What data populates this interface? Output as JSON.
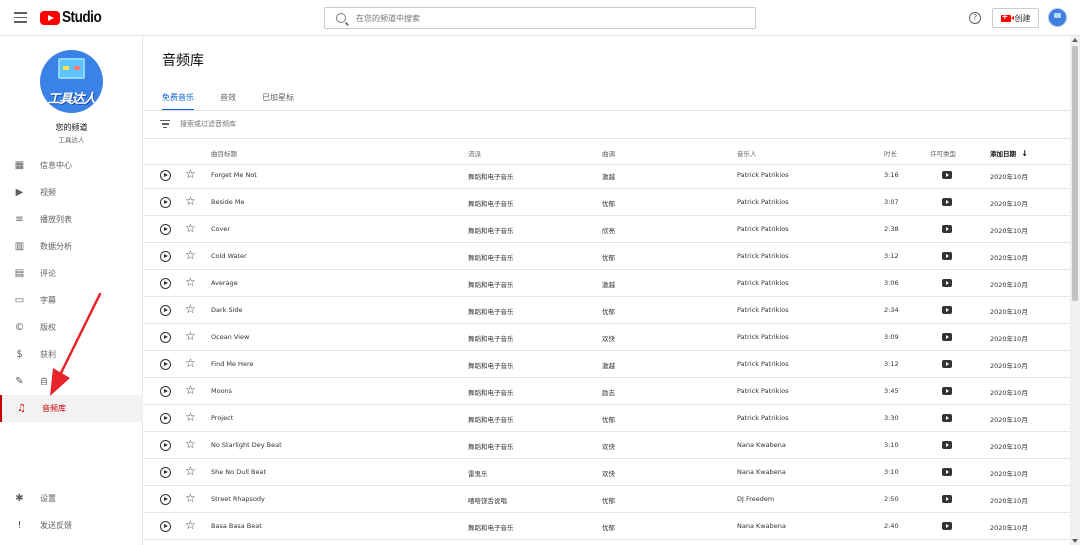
{
  "header": {
    "logo_text": "Studio",
    "search_placeholder": "在您的频道中搜索",
    "help_glyph": "?",
    "create_label": "创建"
  },
  "sidebar": {
    "channel_label": "您的频道",
    "channel_name": "工具达人",
    "avatar_text": "工具达人",
    "items": [
      {
        "label": "信息中心",
        "icon": "dashboard-icon"
      },
      {
        "label": "视频",
        "icon": "video-icon"
      },
      {
        "label": "播放列表",
        "icon": "playlist-icon"
      },
      {
        "label": "数据分析",
        "icon": "analytics-icon"
      },
      {
        "label": "评论",
        "icon": "comments-icon"
      },
      {
        "label": "字幕",
        "icon": "subtitles-icon"
      },
      {
        "label": "版权",
        "icon": "copyright-icon"
      },
      {
        "label": "获利",
        "icon": "monetization-icon"
      },
      {
        "label": "自",
        "icon": "customization-icon"
      },
      {
        "label": "音频库",
        "icon": "audio-library-icon",
        "active": true
      }
    ],
    "bottom_items": [
      {
        "label": "设置",
        "icon": "settings-icon"
      },
      {
        "label": "发送反馈",
        "icon": "feedback-icon"
      }
    ]
  },
  "main": {
    "title": "音频库",
    "tabs": [
      {
        "label": "免费音乐",
        "active": true
      },
      {
        "label": "音效"
      },
      {
        "label": "已加星标"
      }
    ],
    "filter_placeholder": "搜索或过滤音频库",
    "columns": [
      "曲目标题",
      "流派",
      "曲调",
      "音乐人",
      "时长",
      "许可类型",
      "添加日期"
    ],
    "sort_indicator": "↓",
    "rows": [
      {
        "title": "Forget Me Not",
        "genre": "舞蹈和电子音乐",
        "mood": "激越",
        "artist": "Patrick Patrikios",
        "duration": "3:16",
        "date": "2020年10月"
      },
      {
        "title": "Beside Me",
        "genre": "舞蹈和电子音乐",
        "mood": "忧郁",
        "artist": "Patrick Patrikios",
        "duration": "3:07",
        "date": "2020年10月"
      },
      {
        "title": "Cover",
        "genre": "舞蹈和电子音乐",
        "mood": "欣亮",
        "artist": "Patrick Patrikios",
        "duration": "2:38",
        "date": "2020年10月"
      },
      {
        "title": "Cold Water",
        "genre": "舞蹈和电子音乐",
        "mood": "忧郁",
        "artist": "Patrick Patrikios",
        "duration": "3:12",
        "date": "2020年10月"
      },
      {
        "title": "Average",
        "genre": "舞蹈和电子音乐",
        "mood": "激越",
        "artist": "Patrick Patrikios",
        "duration": "3:06",
        "date": "2020年10月"
      },
      {
        "title": "Dark Side",
        "genre": "舞蹈和电子音乐",
        "mood": "忧郁",
        "artist": "Patrick Patrikios",
        "duration": "2:34",
        "date": "2020年10月"
      },
      {
        "title": "Ocean View",
        "genre": "舞蹈和电子音乐",
        "mood": "欢快",
        "artist": "Patrick Patrikios",
        "duration": "3:09",
        "date": "2020年10月"
      },
      {
        "title": "Find Me Here",
        "genre": "舞蹈和电子音乐",
        "mood": "激越",
        "artist": "Patrick Patrikios",
        "duration": "3:12",
        "date": "2020年10月"
      },
      {
        "title": "Moons",
        "genre": "舞蹈和电子音乐",
        "mood": "励志",
        "artist": "Patrick Patrikios",
        "duration": "3:45",
        "date": "2020年10月"
      },
      {
        "title": "Project",
        "genre": "舞蹈和电子音乐",
        "mood": "忧郁",
        "artist": "Patrick Patrikios",
        "duration": "3:30",
        "date": "2020年10月"
      },
      {
        "title": "No Starlight Dey Beat",
        "genre": "舞蹈和电子音乐",
        "mood": "欢快",
        "artist": "Nana Kwabena",
        "duration": "3:10",
        "date": "2020年10月"
      },
      {
        "title": "She No Dull Beat",
        "genre": "雷鬼乐",
        "mood": "欢快",
        "artist": "Nana Kwabena",
        "duration": "3:10",
        "date": "2020年10月"
      },
      {
        "title": "Street Rhapsody",
        "genre": "嘻哈饶舌说唱",
        "mood": "忧郁",
        "artist": "DJ Freedem",
        "duration": "2:50",
        "date": "2020年10月"
      },
      {
        "title": "Basa Basa Beat",
        "genre": "舞蹈和电子音乐",
        "mood": "忧郁",
        "artist": "Nana Kwabena",
        "duration": "2:40",
        "date": "2020年10月"
      }
    ]
  },
  "colors": {
    "brand_red": "#ff0000",
    "active_red": "#cc0000",
    "tab_blue": "#065fd4",
    "annotation_arrow": "#e8232a"
  }
}
